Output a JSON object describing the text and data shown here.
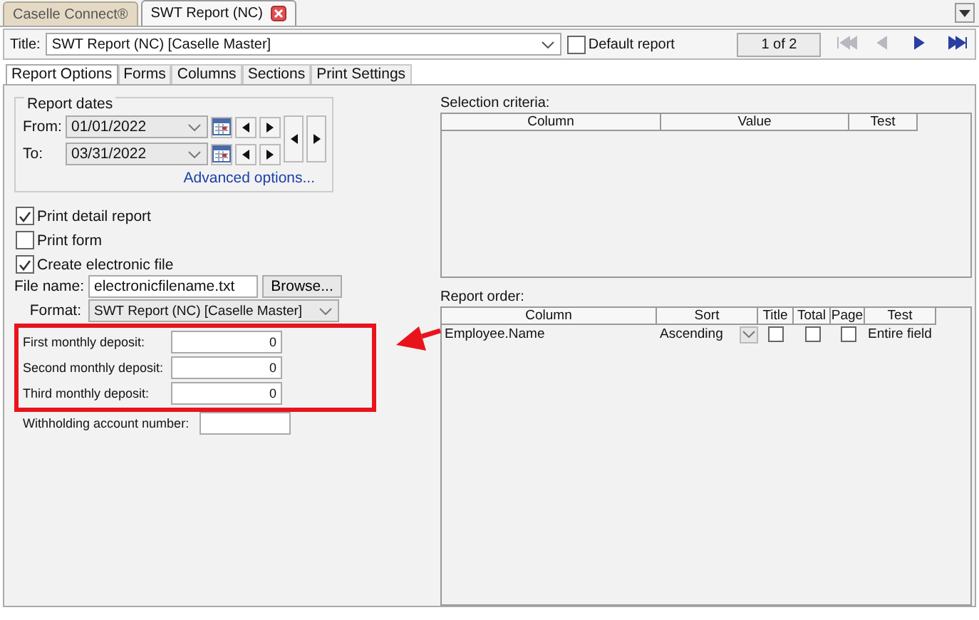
{
  "tabs": [
    {
      "label": "Caselle Connect®",
      "selected": false,
      "closable": false
    },
    {
      "label": "SWT Report (NC)",
      "selected": true,
      "closable": true
    }
  ],
  "toolbar": {
    "title_label": "Title:",
    "title_value": "SWT Report (NC) [Caselle Master]",
    "default_report": {
      "label": "Default report",
      "checked": false
    },
    "record_counter": "1 of 2",
    "nav": [
      {
        "kind": "first",
        "disabled": true
      },
      {
        "kind": "prev",
        "disabled": true
      },
      {
        "kind": "next",
        "disabled": false
      },
      {
        "kind": "last",
        "disabled": false
      }
    ]
  },
  "subtabs": [
    {
      "label": "Report Options",
      "selected": true
    },
    {
      "label": "Forms",
      "selected": false
    },
    {
      "label": "Columns",
      "selected": false
    },
    {
      "label": "Sections",
      "selected": false
    },
    {
      "label": "Print Settings",
      "selected": false
    }
  ],
  "report_dates": {
    "legend": "Report dates",
    "rows": [
      {
        "label": "From:",
        "value": "01/01/2022"
      },
      {
        "label": "To:",
        "value": "03/31/2022"
      }
    ],
    "link": "Advanced options..."
  },
  "options": [
    {
      "label": "Print detail report",
      "checked": true
    },
    {
      "label": "Print form",
      "checked": false
    },
    {
      "label": "Create electronic file",
      "checked": true
    }
  ],
  "file_name": {
    "label": "File name:",
    "value": "electronicfilename.txt",
    "button": "Browse..."
  },
  "format": {
    "label": "Format:",
    "value": "SWT Report (NC) [Caselle Master]"
  },
  "deposits": {
    "highlighted": true,
    "fields": [
      {
        "label": "First monthly deposit:",
        "value": "0"
      },
      {
        "label": "Second monthly deposit:",
        "value": "0"
      },
      {
        "label": "Third monthly deposit:",
        "value": "0"
      }
    ]
  },
  "withholding": {
    "label": "Withholding account number:"
  },
  "selection_criteria": {
    "label": "Selection criteria:",
    "columns": [
      "Column",
      "Value",
      "Test"
    ]
  },
  "report_order": {
    "label": "Report order:",
    "columns": [
      "Column",
      "Sort",
      "Title",
      "Total",
      "Page",
      "Test"
    ],
    "rows": [
      {
        "column": "Employee.Name",
        "sort": "Ascending",
        "title": false,
        "total": false,
        "page": false,
        "test": "Entire field"
      }
    ]
  }
}
